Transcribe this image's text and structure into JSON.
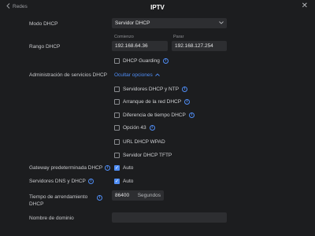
{
  "header": {
    "back_label": "Redes",
    "title": "IPTV"
  },
  "dhcp_mode": {
    "label": "Modo DHCP",
    "value": "Servidor DHCP"
  },
  "range": {
    "label": "Rango DHCP",
    "start_label": "Comienzo",
    "start_value": "192.168.64.36",
    "end_label": "Parar",
    "end_value": "192.168.127.254"
  },
  "dhcp_guarding": {
    "label": "DHCP Guarding"
  },
  "service_admin": {
    "label": "Administración de servicios DHCP",
    "toggle_label": "Ocultar opciones"
  },
  "options": [
    {
      "label": "Servidores DHCP y NTP",
      "info": true
    },
    {
      "label": "Arranque de la red DHCP",
      "info": true
    },
    {
      "label": "Diferencia de tiempo DHCP",
      "info": true
    },
    {
      "label": "Opción 43",
      "info": true
    },
    {
      "label": "URL DHCP WPAD",
      "info": false
    },
    {
      "label": "Servidor DHCP TFTP",
      "info": false
    }
  ],
  "gateway": {
    "label": "Gateway predeterminada DHCP",
    "value": "Auto"
  },
  "dns": {
    "label": "Servidores DNS y DHCP",
    "value": "Auto"
  },
  "lease": {
    "label": "Tiempo de arrendamiento DHCP",
    "value": "86400",
    "unit": "Segundos"
  },
  "domain": {
    "label": "Nombre de dominio",
    "value": ""
  }
}
